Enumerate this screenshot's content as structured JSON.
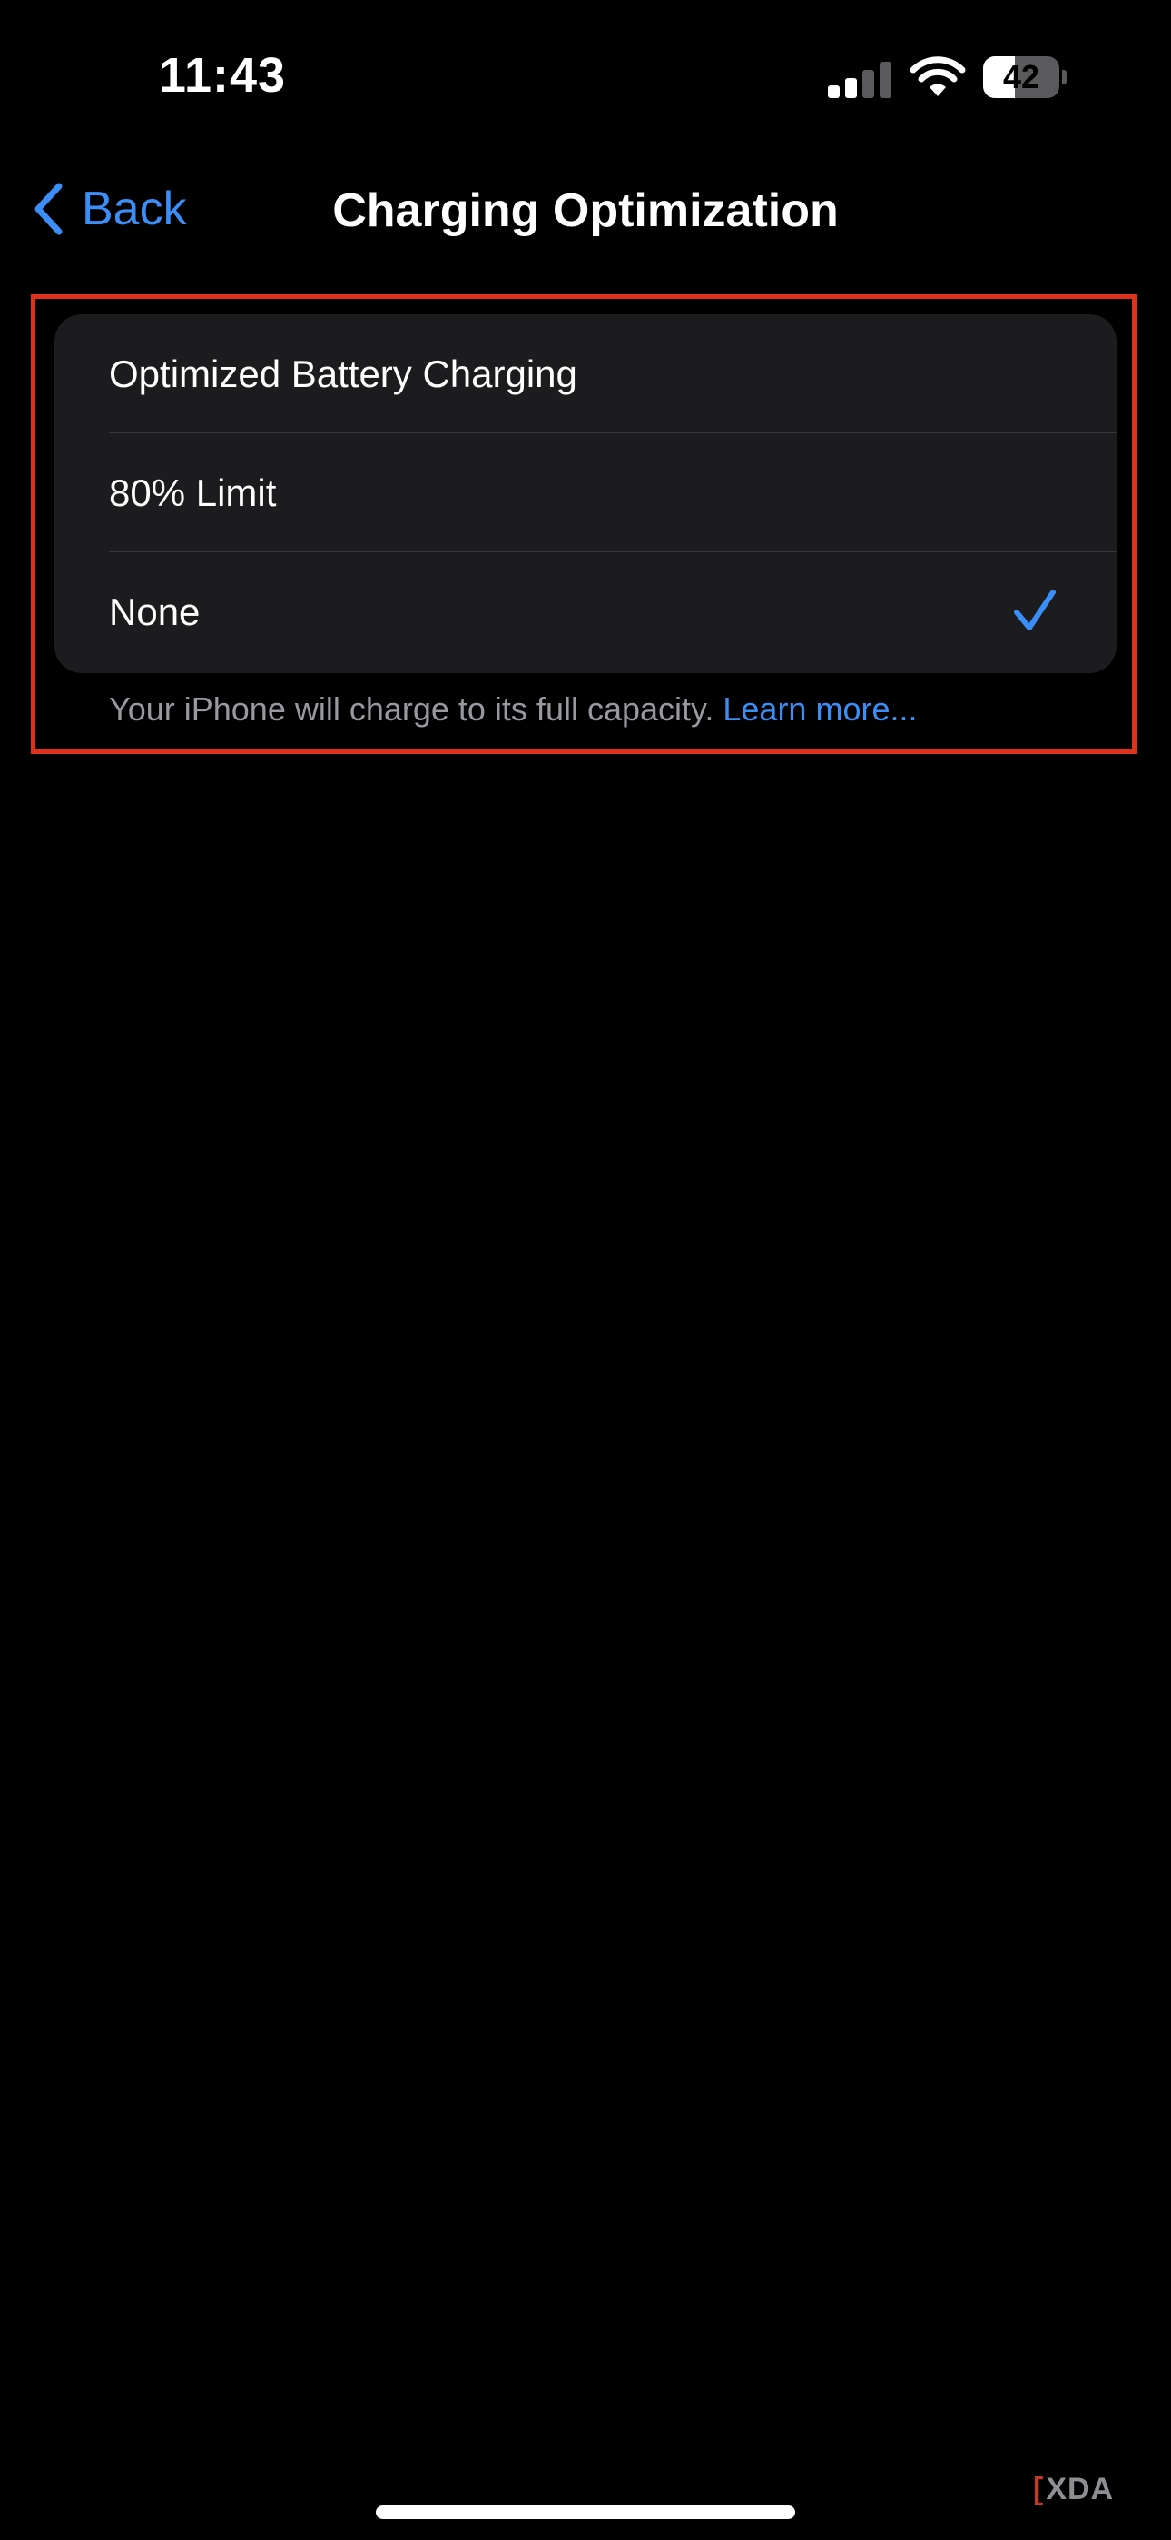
{
  "status_bar": {
    "time": "11:43",
    "battery_percent": 42,
    "battery_label": "42",
    "signal_bars_active": 2,
    "signal_bars_total": 4,
    "icons": [
      "cellular-signal-icon",
      "wifi-icon",
      "battery-icon"
    ]
  },
  "nav": {
    "back_label": "Back",
    "title": "Charging Optimization"
  },
  "options": [
    {
      "label": "Optimized Battery Charging",
      "selected": false
    },
    {
      "label": "80% Limit",
      "selected": false
    },
    {
      "label": "None",
      "selected": true
    }
  ],
  "footer": {
    "text": "Your iPhone will charge to its full capacity.",
    "link": "Learn more..."
  },
  "watermark": {
    "text": "XDA"
  },
  "colors": {
    "background": "#000000",
    "card": "#1c1c1e",
    "accent": "#3a8ef6",
    "highlight_border": "#e0311c",
    "secondary_text": "#98989f"
  }
}
